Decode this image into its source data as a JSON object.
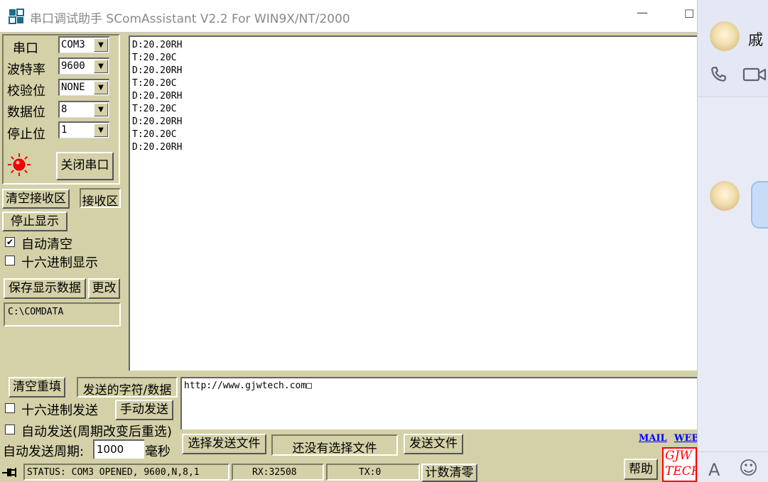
{
  "window": {
    "title": "串口调试助手 SComAssistant V2.2 For WIN9X/NT/2000",
    "minimize_glyph": "—",
    "maximize_glyph": "☐"
  },
  "serial_settings": {
    "port_label": "串口",
    "port_value": "COM3",
    "baud_label": "波特率",
    "baud_value": "9600",
    "parity_label": "校验位",
    "parity_value": "NONE",
    "databits_label": "数据位",
    "databits_value": "8",
    "stopbits_label": "停止位",
    "stopbits_value": "1",
    "close_port_button": "关闭串口",
    "indicator_color": "#ff0000"
  },
  "receive": {
    "clear_button": "清空接收区",
    "area_button": "接收区",
    "stop_display_button": "停止显示",
    "auto_clear_label": "自动清空",
    "auto_clear_checked": true,
    "hex_display_label": "十六进制显示",
    "hex_display_checked": false,
    "save_button": "保存显示数据",
    "change_button": "更改",
    "save_path": "C:\\COMDATA",
    "lines": [
      "D:20.20RH",
      "T:20.20C",
      "D:20.20RH",
      "T:20.20C",
      "D:20.20RH",
      "T:20.20C",
      "D:20.20RH",
      "T:20.20C",
      "D:20.20RH"
    ]
  },
  "send": {
    "clear_button": "清空重填",
    "area_button": "发送的字符/数据",
    "hex_send_label": "十六进制发送",
    "hex_send_checked": false,
    "manual_send_button": "手动发送",
    "auto_send_label": "自动发送(周期改变后重选)",
    "auto_send_checked": false,
    "period_label": "自动发送周期:",
    "period_value": "1000",
    "period_unit": "毫秒",
    "choose_file_button": "选择发送文件",
    "file_status": "还没有选择文件",
    "send_file_button": "发送文件",
    "text": "http://www.gjwtech.com□"
  },
  "links": {
    "mail": "MAIL",
    "web": "WEB"
  },
  "status_bar": {
    "status": "STATUS: COM3 OPENED, 9600,N,8,1",
    "rx": "RX:32508",
    "tx": "TX:0",
    "reset_button": "计数清零",
    "help_button": "帮助",
    "logo_text_top": "GJW",
    "logo_text_bottom": "TECH"
  },
  "chat_panel": {
    "contact_name": "戚",
    "phone_icon": "phone-icon",
    "video_icon": "video-icon",
    "font_glyph": "A",
    "emoji_glyph": "☺"
  }
}
